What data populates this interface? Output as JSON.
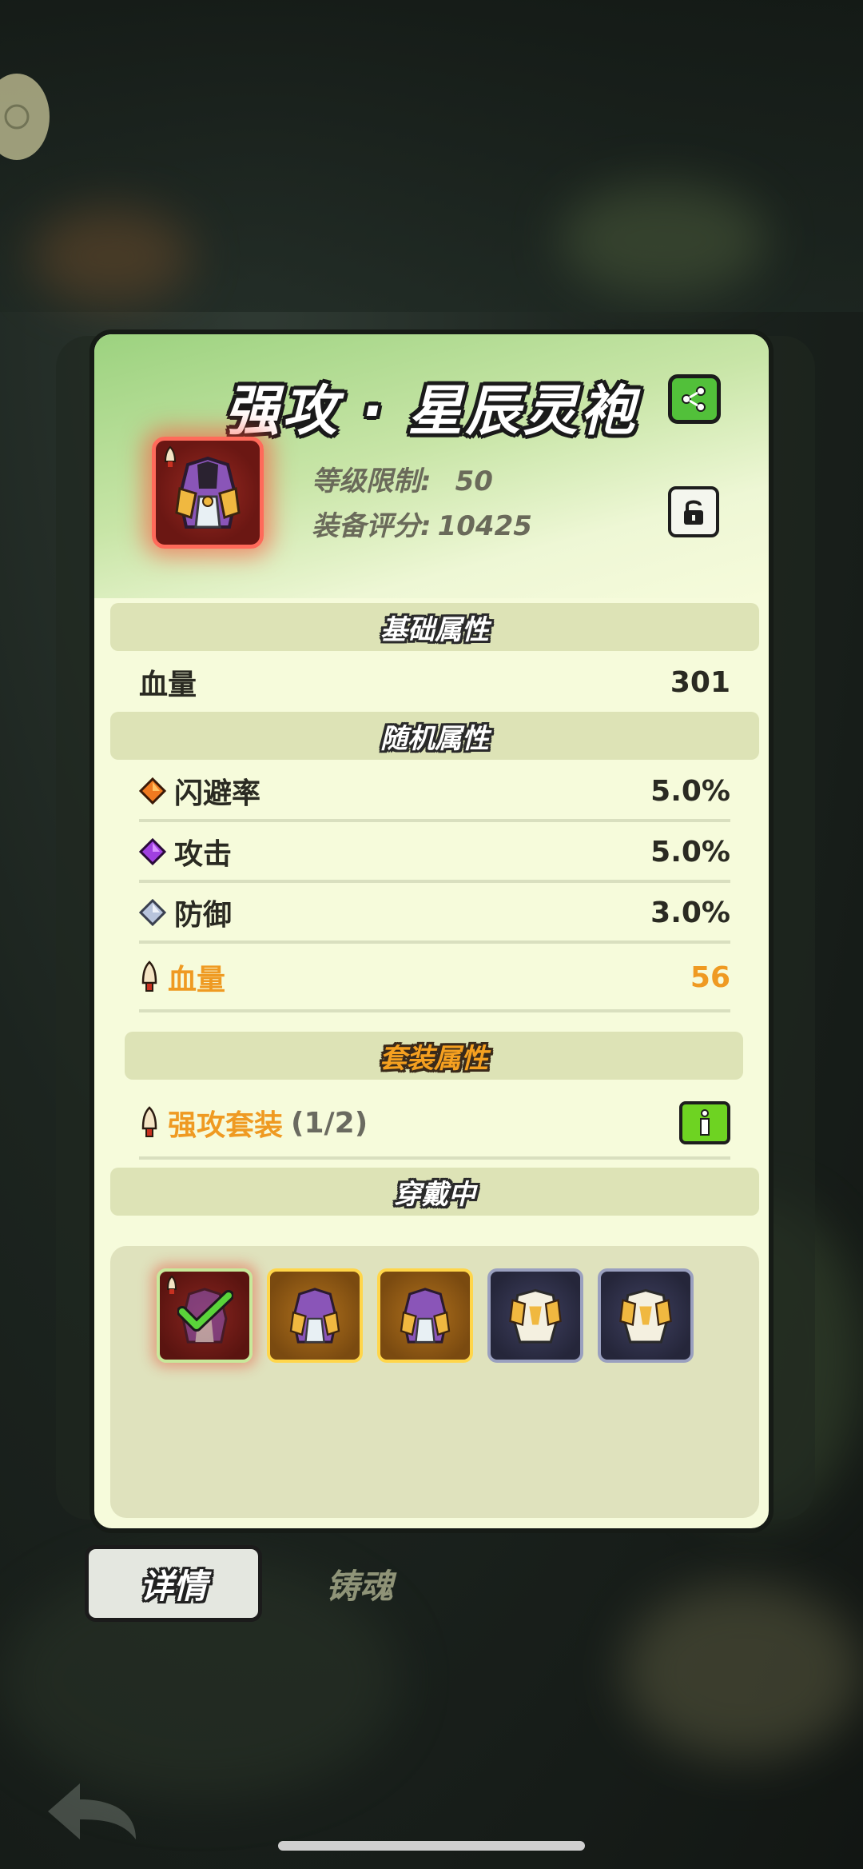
{
  "item": {
    "title": "强攻 · 星辰灵袍",
    "level_label": "等级限制:",
    "level_value": "50",
    "score_label": "装备评分:",
    "score_value": "10425"
  },
  "sections": {
    "base": "基础属性",
    "random": "随机属性",
    "set": "套装属性",
    "wearing": "穿戴中"
  },
  "base_stats": [
    {
      "label": "血量",
      "value": "301"
    }
  ],
  "random_stats": [
    {
      "label": "闪避率",
      "value": "5.0%",
      "gem": "orange-gem-icon"
    },
    {
      "label": "攻击",
      "value": "5.0%",
      "gem": "purple-gem-icon"
    },
    {
      "label": "防御",
      "value": "3.0%",
      "gem": "silver-gem-icon"
    },
    {
      "label": "血量",
      "value": "56",
      "gem": "bell-icon",
      "highlight": true
    }
  ],
  "set_bonus": {
    "name": "强攻套装",
    "count": "(1/2)"
  },
  "tabs": {
    "details": "详情",
    "soul": "铸魂"
  },
  "colors": {
    "orange_text": "#ef9a22",
    "green_button": "#6ed322",
    "card_bg": "#f6fbdb"
  }
}
